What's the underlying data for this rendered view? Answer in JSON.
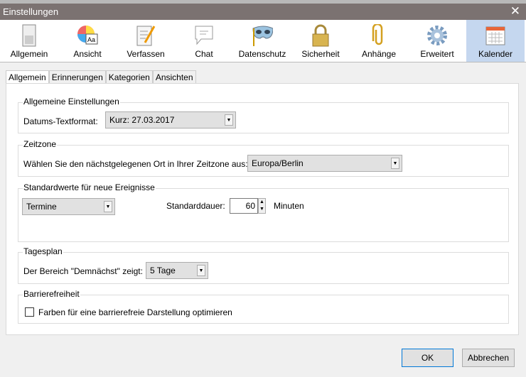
{
  "window": {
    "title": "Einstellungen"
  },
  "toolbar": [
    {
      "label": "Allgemein",
      "icon": "switch-icon"
    },
    {
      "label": "Ansicht",
      "icon": "color-font-icon"
    },
    {
      "label": "Verfassen",
      "icon": "compose-icon"
    },
    {
      "label": "Chat",
      "icon": "chat-bubble-icon"
    },
    {
      "label": "Datenschutz",
      "icon": "mask-icon"
    },
    {
      "label": "Sicherheit",
      "icon": "lock-icon"
    },
    {
      "label": "Anhänge",
      "icon": "paperclip-icon"
    },
    {
      "label": "Erweitert",
      "icon": "gear-icon"
    },
    {
      "label": "Kalender",
      "icon": "calendar-icon",
      "selected": true
    }
  ],
  "tabs": [
    "Allgemein",
    "Erinnerungen",
    "Kategorien",
    "Ansichten"
  ],
  "general": {
    "legend": "Allgemeine Einstellungen",
    "date_label": "Datums-Textformat:",
    "date_value": "Kurz: 27.03.2017"
  },
  "timezone": {
    "legend": "Zeitzone",
    "label": "Wählen Sie den nächstgelegenen Ort in Ihrer Zeitzone aus:",
    "value": "Europa/Berlin"
  },
  "defaults": {
    "legend": "Standardwerte für neue Ereignisse",
    "type_value": "Termine",
    "duration_label": "Standarddauer:",
    "duration_value": "60",
    "unit": "Minuten"
  },
  "agenda": {
    "legend": "Tagesplan",
    "label": "Der Bereich \"Demnächst\" zeigt:",
    "value": "5 Tage"
  },
  "accessibility": {
    "legend": "Barrierefreiheit",
    "checkbox_label": "Farben für eine barrierefreie Darstellung optimieren",
    "checked": false
  },
  "buttons": {
    "ok": "OK",
    "cancel": "Abbrechen"
  }
}
